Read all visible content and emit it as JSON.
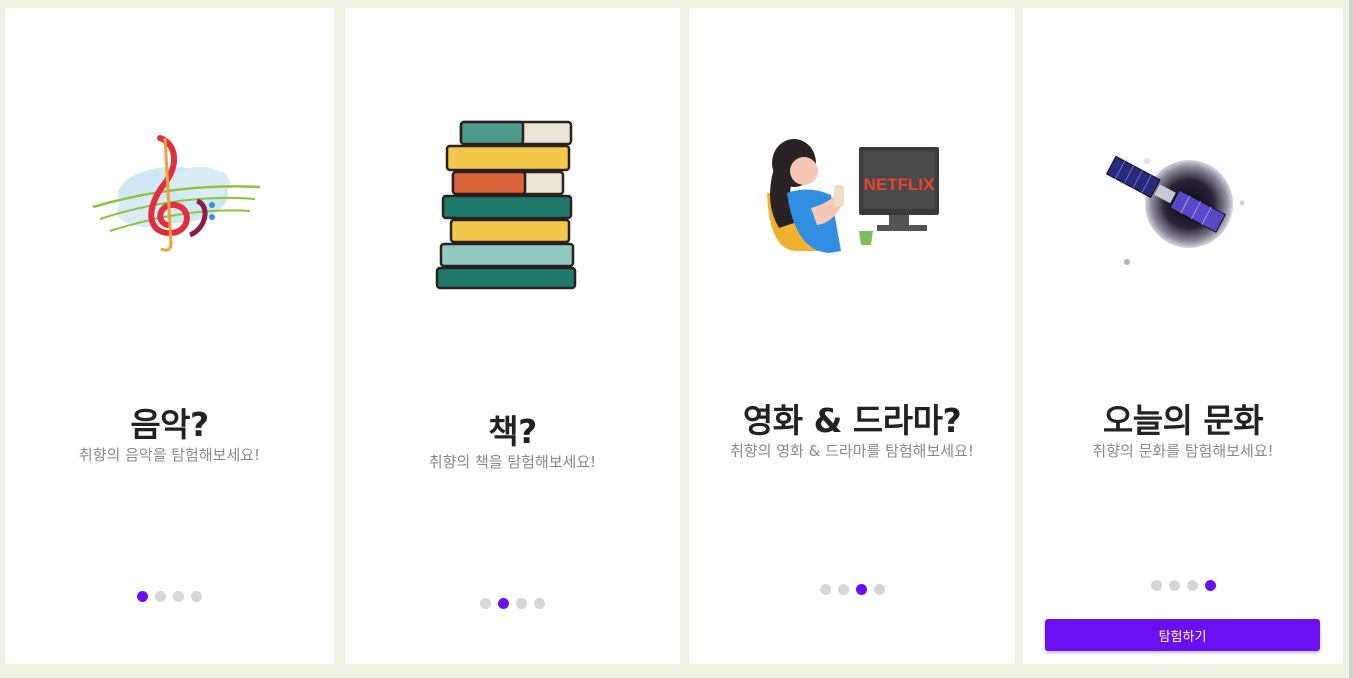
{
  "slides": [
    {
      "title": "음악?",
      "subtitle": "취향의 음악을 탐험해보세요!",
      "illustration": "music-notes-illustration",
      "active_dot": 1
    },
    {
      "title": "책?",
      "subtitle": "취향의 책을 탐험해보세요!",
      "illustration": "book-stack-illustration",
      "active_dot": 2
    },
    {
      "title": "영화 & 드라마?",
      "subtitle": "취향의 영화 & 드라마를 탐험해보세요!",
      "illustration": "tv-watching-illustration",
      "tv_brand": "NETFLIX",
      "active_dot": 3
    },
    {
      "title": "오늘의 문화",
      "subtitle": "취향의 문화를 탐험해보세요!",
      "illustration": "satellite-illustration",
      "active_dot": 4,
      "button": "탐험하기"
    }
  ],
  "pagination_total": 4,
  "colors": {
    "accent": "#6a0ff0",
    "background": "#eef0e2",
    "dot_inactive": "#d6d6d6",
    "title": "#222222",
    "subtitle": "#8a8a8a"
  }
}
